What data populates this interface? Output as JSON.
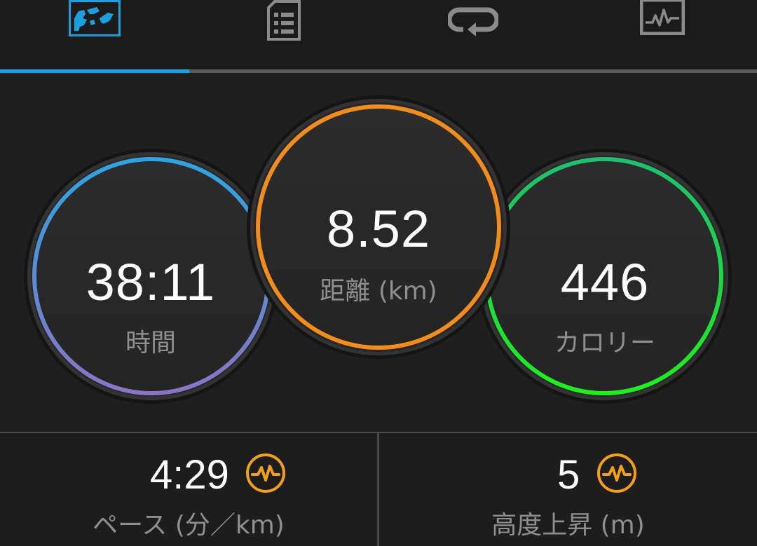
{
  "tabs": [
    {
      "name": "map-icon",
      "active": true
    },
    {
      "name": "details-icon",
      "active": false
    },
    {
      "name": "laps-icon",
      "active": false
    },
    {
      "name": "chart-icon",
      "active": false
    }
  ],
  "colors": {
    "active_tab": "#1aa0e0",
    "inactive_tab": "#8a8a8a",
    "time_ring_top": "#2ea4e0",
    "time_ring_bottom": "#8a74c4",
    "distance_ring": "#f28c1c",
    "calorie_ring_top": "#1fbf6e",
    "calorie_ring_bottom": "#1ef01e",
    "badge": "#f2a01c"
  },
  "rings": {
    "time": {
      "value": "38:11",
      "label": "時間"
    },
    "distance": {
      "value": "8.52",
      "label": "距離 (km)"
    },
    "calories": {
      "value": "446",
      "label": "カロリー"
    }
  },
  "stats": {
    "pace": {
      "value": "4:29",
      "label": "ペース (分／km)",
      "icon": "pulse-badge-icon"
    },
    "elevation": {
      "value": "5",
      "label": "高度上昇 (m)",
      "icon": "pulse-badge-icon"
    }
  }
}
